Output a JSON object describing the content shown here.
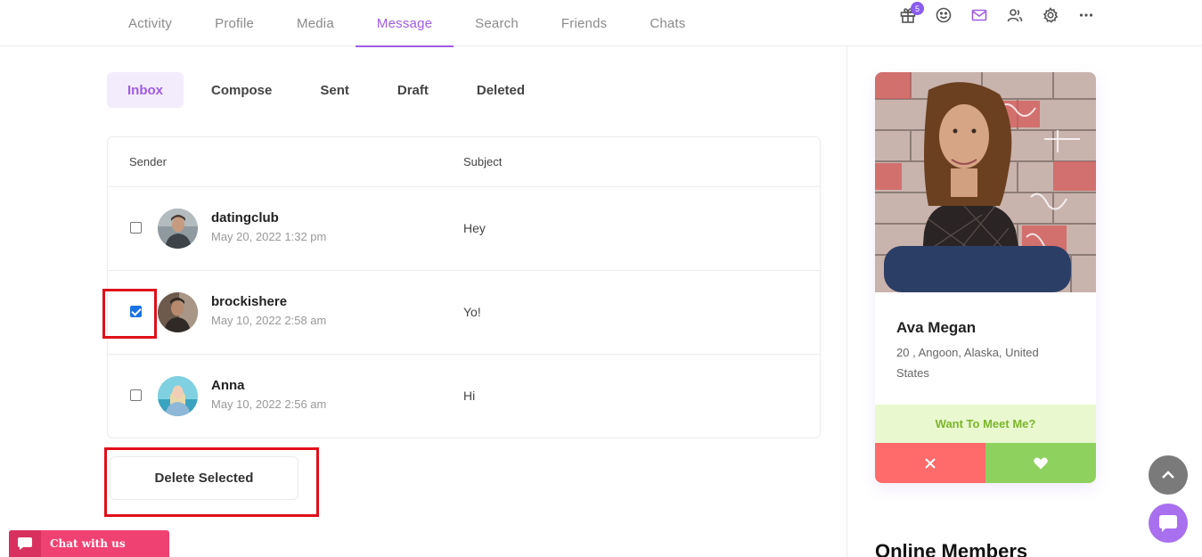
{
  "nav": {
    "tabs": [
      {
        "label": "Activity",
        "active": false
      },
      {
        "label": "Profile",
        "active": false
      },
      {
        "label": "Media",
        "active": false
      },
      {
        "label": "Message",
        "active": true
      },
      {
        "label": "Search",
        "active": false
      },
      {
        "label": "Friends",
        "active": false
      },
      {
        "label": "Chats",
        "active": false
      }
    ],
    "icons": [
      "gift-icon",
      "smiley-icon",
      "mail-icon",
      "friends-icon",
      "gear-icon",
      "more-icon"
    ],
    "gift_badge": "5",
    "accent": "#a05ce4"
  },
  "subtabs": [
    {
      "label": "Inbox",
      "active": true
    },
    {
      "label": "Compose",
      "active": false
    },
    {
      "label": "Sent",
      "active": false
    },
    {
      "label": "Draft",
      "active": false
    },
    {
      "label": "Deleted",
      "active": false
    }
  ],
  "table": {
    "headers": {
      "sender": "Sender",
      "subject": "Subject"
    },
    "rows": [
      {
        "name": "datingclub",
        "date": "May 20, 2022 1:32 pm",
        "subject": "Hey",
        "checked": false
      },
      {
        "name": "brockishere",
        "date": "May 10, 2022 2:58 am",
        "subject": "Yo!",
        "checked": true
      },
      {
        "name": "Anna",
        "date": "May 10, 2022 2:56 am",
        "subject": "Hi",
        "checked": false
      }
    ]
  },
  "actions": {
    "delete_selected": "Delete Selected"
  },
  "profile_card": {
    "name": "Ava Megan",
    "location": "20 , Angoon, Alaska, United States",
    "meet_label": "Want To Meet Me?",
    "no_color": "#ff6b6b",
    "yes_color": "#8fd15e"
  },
  "sidebar": {
    "online_title": "Online Members"
  },
  "chat_widget": {
    "label": "Chat with us",
    "color": "#f04272"
  }
}
